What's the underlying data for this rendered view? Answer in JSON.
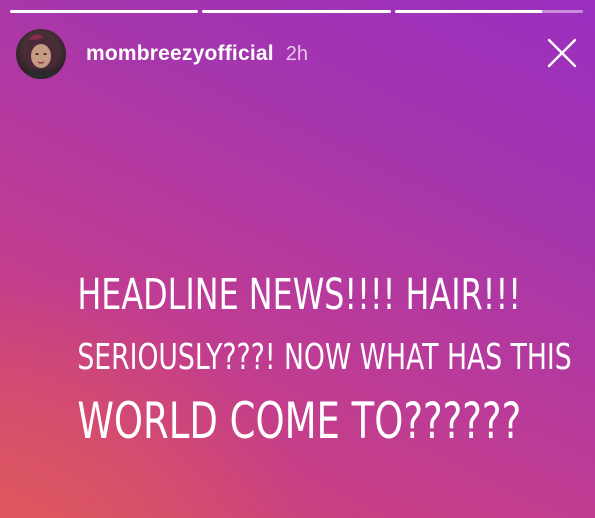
{
  "story": {
    "progress": [
      1.0,
      1.0,
      0.78
    ]
  },
  "header": {
    "username": "mombreezyofficial",
    "time_ago": "2h",
    "close_icon": "close-icon",
    "avatar_icon": "avatar"
  },
  "caption": {
    "line1": "HEADLINE NEWS!!!!  HAIR!!!",
    "line2": "SERIOUSLY???! NOW WHAT HAS THIS",
    "line3": "WORLD COME TO??????"
  }
}
